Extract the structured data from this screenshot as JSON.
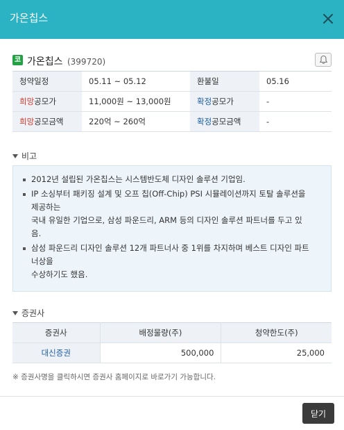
{
  "window": {
    "title": "가온칩스"
  },
  "stock": {
    "badge": "코",
    "name": "가온칩스",
    "code": "(399720)"
  },
  "info": {
    "row1": {
      "label": "청약일정",
      "value": "05.11 ~ 05.12",
      "label2": "환불일",
      "value2": "05.16"
    },
    "row2": {
      "label_red": "희망",
      "label_rest": "공모가",
      "value": "11,000원 ~ 13,000원",
      "label2_blue": "확정",
      "label2_rest": "공모가",
      "value2": "-"
    },
    "row3": {
      "label_red": "희망",
      "label_rest": "공모금액",
      "value": "220억 ~ 260억",
      "label2_blue": "확정",
      "label2_rest": "공모금액",
      "value2": "-"
    }
  },
  "notes": {
    "title": "비고",
    "items": [
      {
        "lines": [
          "2012년 설립된 가온칩스는 시스템반도체 디자인 솔루션 기업임."
        ]
      },
      {
        "lines": [
          "IP 소싱부터 패키징 설계 및 오프 칩(Off-Chip) PSI 시뮬레이션까지 토탈 솔루션을",
          "제공하는",
          "국내 유일한 기업으로, 삼성 파운드리, ARM 등의 디자인 솔루션 파트너를 두고 있",
          "음."
        ]
      },
      {
        "lines": [
          "삼성 파운드리 디자인 솔루션 12개 파트너사 중 1위를 차지하며 베스트 디자인 파트",
          "너상을",
          "수상하기도 했음."
        ]
      }
    ]
  },
  "brokers": {
    "title": "증권사",
    "headers": [
      "증권사",
      "배정물량(주)",
      "청약한도(주)"
    ],
    "rows": [
      {
        "name": "대신증권",
        "allocation": "500,000",
        "limit": "25,000"
      }
    ]
  },
  "footnote": "※ 증권사명을 클릭하시면 증권사 홈페이지로 바로가기 가능합니다.",
  "buttons": {
    "close": "닫기"
  }
}
